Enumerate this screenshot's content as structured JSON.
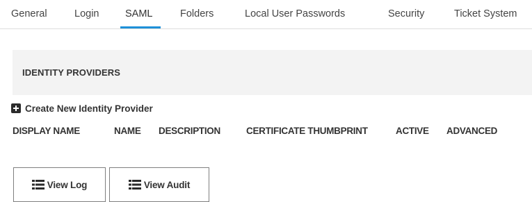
{
  "tabs": [
    {
      "label": "General"
    },
    {
      "label": "Login"
    },
    {
      "label": "SAML",
      "active": true
    },
    {
      "label": "Folders"
    },
    {
      "label": "Local User Passwords"
    },
    {
      "label": "Security"
    },
    {
      "label": "Ticket System"
    }
  ],
  "section": {
    "title": "IDENTITY PROVIDERS",
    "create_label": "Create New Identity Provider",
    "create_icon": "plus-square-icon"
  },
  "columns": [
    "DISPLAY NAME",
    "NAME",
    "DESCRIPTION",
    "CERTIFICATE THUMBPRINT",
    "ACTIVE",
    "ADVANCED"
  ],
  "buttons": {
    "view_log": {
      "label": "View Log",
      "icon": "list-icon"
    },
    "view_audit": {
      "label": "View Audit",
      "icon": "list-icon"
    }
  },
  "colors": {
    "accent": "#1e90d8",
    "header_background": "#f3f3f3"
  }
}
